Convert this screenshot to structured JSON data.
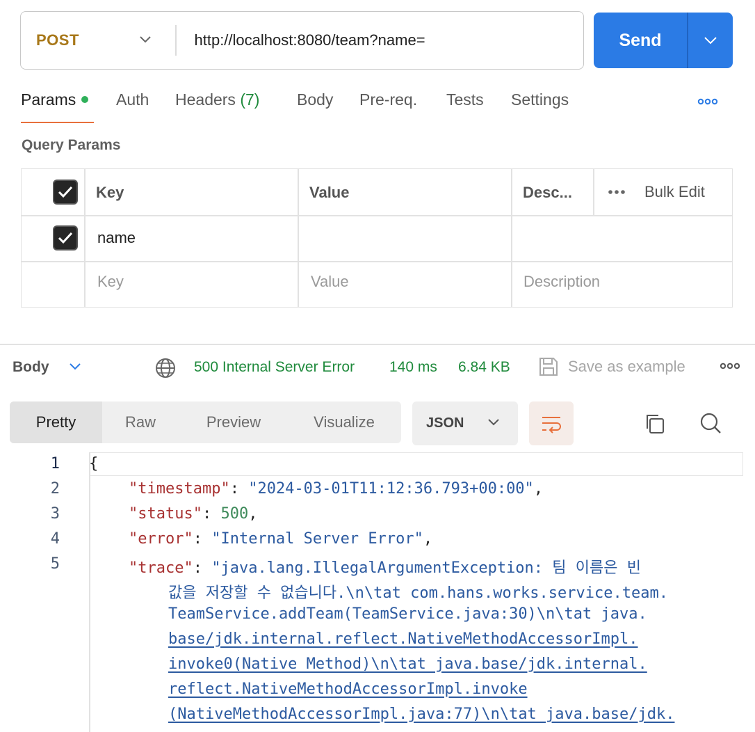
{
  "request": {
    "method": "POST",
    "url": "http://localhost:8080/team?name=",
    "send_label": "Send"
  },
  "tabs": {
    "params": "Params",
    "auth": "Auth",
    "headers": "Headers",
    "headers_count": "(7)",
    "body": "Body",
    "prereq": "Pre-req.",
    "tests": "Tests",
    "settings": "Settings"
  },
  "query_params": {
    "title": "Query Params",
    "columns": {
      "key": "Key",
      "value": "Value",
      "description": "Desc...",
      "bulk_edit": "Bulk Edit"
    },
    "rows": [
      {
        "key": "name",
        "value": "",
        "description": "",
        "checked": true
      }
    ],
    "placeholders": {
      "key": "Key",
      "value": "Value",
      "description": "Description"
    }
  },
  "response": {
    "body_label": "Body",
    "status": "500 Internal Server Error",
    "time": "140 ms",
    "size": "6.84 KB",
    "save_example": "Save as example",
    "format_tabs": [
      "Pretty",
      "Raw",
      "Preview",
      "Visualize"
    ],
    "active_format": "Pretty",
    "language": "JSON",
    "line_numbers": [
      "1",
      "2",
      "3",
      "4",
      "5"
    ],
    "json": {
      "open_brace": "{",
      "timestamp_key": "\"timestamp\"",
      "timestamp_val": "\"2024-03-01T11:12:36.793+00:00\"",
      "status_key": "\"status\"",
      "status_val": "500",
      "error_key": "\"error\"",
      "error_val": "\"Internal Server Error\"",
      "trace_key": "\"trace\"",
      "trace_lines": [
        "\"java.lang.IllegalArgumentException: 팀 이름은 빈",
        "값을 저장할 수 없습니다.\\n\\tat com.hans.works.service.team.",
        "TeamService.addTeam(TeamService.java:30)\\n\\tat java.",
        "base/jdk.internal.reflect.NativeMethodAccessorImpl.",
        "invoke0(Native Method)\\n\\tat java.base/jdk.internal.",
        "reflect.NativeMethodAccessorImpl.invoke",
        "(NativeMethodAccessorImpl.java:77)\\n\\tat java.base/jdk."
      ]
    }
  },
  "colors": {
    "method": "#a8781a",
    "send": "#2b7be5",
    "status_ok_green": "#1f8a3c",
    "active_tab_underline": "#e8703c"
  },
  "icons": [
    "chevron-down-icon",
    "more-icon",
    "checkbox-checked-icon",
    "globe-icon",
    "save-icon",
    "wrap-lines-icon",
    "copy-icon",
    "search-icon"
  ]
}
